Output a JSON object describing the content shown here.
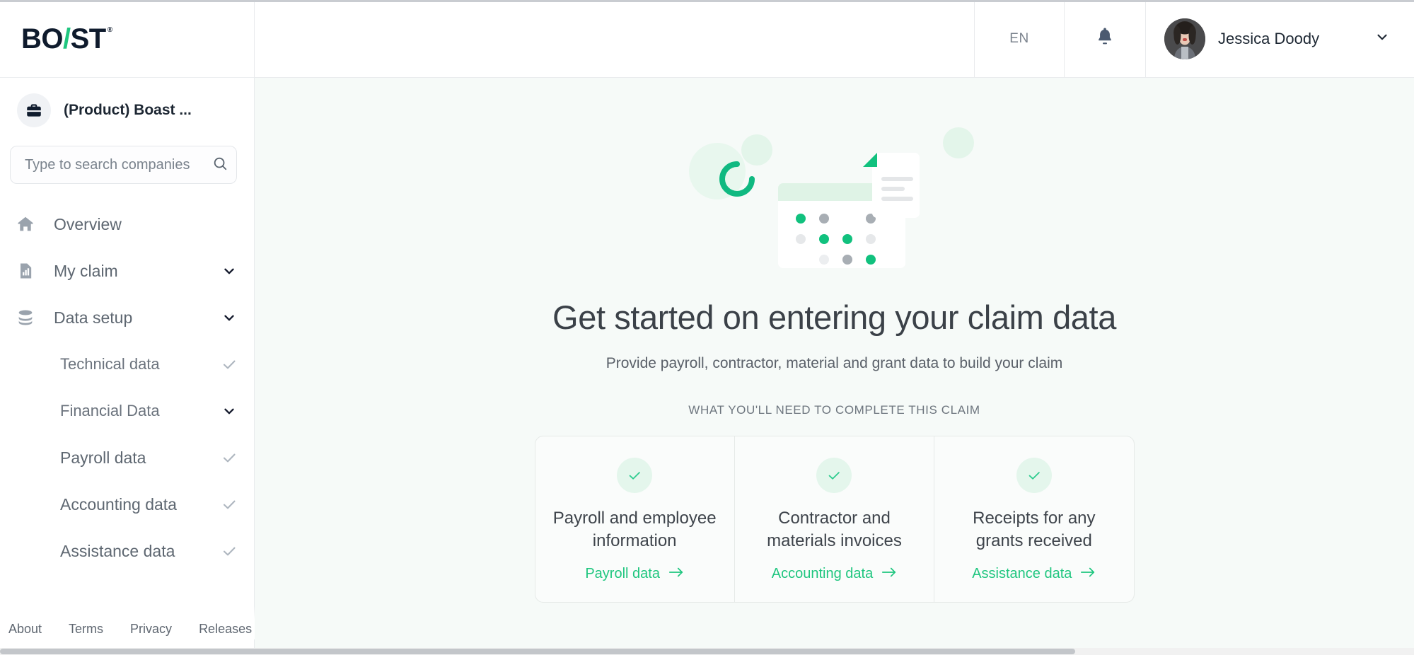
{
  "brand": {
    "logo_part1": "BO",
    "logo_slash": "/\\",
    "logo_part2": "ST",
    "registered_mark": "®",
    "accent_green": "#1fc67f",
    "dark": "#0f1b2d"
  },
  "sidebar": {
    "company": {
      "name": "(Product) Boast ...",
      "icon": "briefcase-icon"
    },
    "search": {
      "placeholder": "Type to search companies",
      "value": "",
      "icon": "search-icon"
    },
    "nav": [
      {
        "label": "Overview",
        "icon": "home-icon",
        "level": "top",
        "trailing": "none"
      },
      {
        "label": "My claim",
        "icon": "chart-doc-icon",
        "level": "top",
        "trailing": "chevron-down"
      },
      {
        "label": "Data setup",
        "icon": "database-icon",
        "level": "top",
        "trailing": "chevron-down"
      },
      {
        "label": "Technical data",
        "icon": "",
        "level": "sub",
        "trailing": "check"
      },
      {
        "label": "Financial Data",
        "icon": "",
        "level": "sub",
        "trailing": "chevron-down"
      },
      {
        "label": "Payroll data",
        "icon": "",
        "level": "sub2",
        "trailing": "check"
      },
      {
        "label": "Accounting data",
        "icon": "",
        "level": "sub2",
        "trailing": "check"
      },
      {
        "label": "Assistance data",
        "icon": "",
        "level": "sub2",
        "trailing": "check"
      }
    ],
    "footer_links": [
      "About",
      "Terms",
      "Privacy",
      "Releases"
    ]
  },
  "header": {
    "language": "EN",
    "bell_icon": "notification-bell-icon",
    "user": {
      "name": "Jessica Doody",
      "chevron": "chevron-down-icon"
    }
  },
  "main": {
    "illustration": "claim-data-illustration",
    "title": "Get started on entering your claim data",
    "subtitle": "Provide payroll, contractor, material and grant data to build your claim",
    "section_label": "WHAT YOU'LL NEED TO COMPLETE THIS CLAIM",
    "cards": [
      {
        "badge_icon": "check-icon",
        "title": "Payroll and employee information",
        "link_label": "Payroll data",
        "link_icon": "arrow-right-icon"
      },
      {
        "badge_icon": "check-icon",
        "title": "Contractor and materials invoices",
        "link_label": "Accounting data",
        "link_icon": "arrow-right-icon"
      },
      {
        "badge_icon": "check-icon",
        "title": "Receipts for any grants received",
        "link_label": "Assistance data",
        "link_icon": "arrow-right-icon"
      }
    ]
  }
}
